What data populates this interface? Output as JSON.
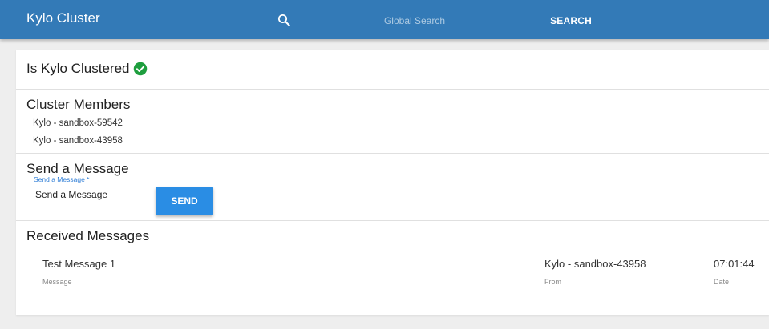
{
  "app": {
    "title": "Kylo Cluster"
  },
  "search": {
    "placeholder": "Global Search",
    "value": "",
    "button_label": "SEARCH"
  },
  "clustered": {
    "title": "Is Kylo Clustered",
    "status": true,
    "status_color": "#1e9e3e"
  },
  "members": {
    "title": "Cluster Members",
    "items": [
      "Kylo - sandbox-59542",
      "Kylo - sandbox-43958"
    ]
  },
  "send": {
    "title": "Send a Message",
    "field_label": "Send a Message *",
    "field_value": "Send a Message",
    "button_label": "SEND"
  },
  "received": {
    "title": "Received Messages",
    "columns": {
      "message": "Message",
      "from": "From",
      "date": "Date"
    },
    "rows": [
      {
        "message": "Test Message 1",
        "from": "Kylo - sandbox-43958",
        "date": "07:01:44"
      }
    ]
  },
  "colors": {
    "primary": "#337ab7",
    "accent": "#2a8de4",
    "success": "#1e9e3e"
  }
}
